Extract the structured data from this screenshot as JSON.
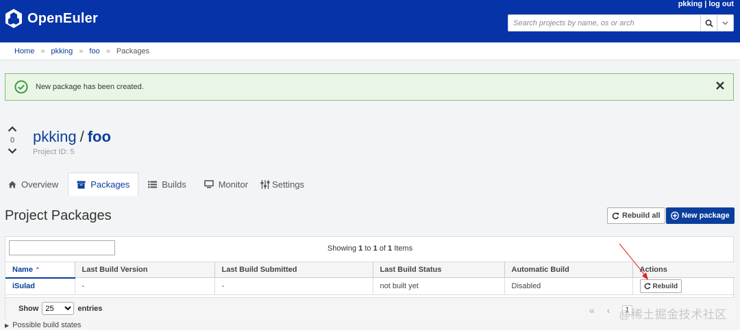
{
  "header": {
    "brand": "OpenEuler",
    "user": "pkking",
    "logout": "log out",
    "search_placeholder": "Search projects by name, os or arch"
  },
  "breadcrumb": {
    "items": [
      "Home",
      "pkking",
      "foo"
    ],
    "current": "Packages"
  },
  "alert": {
    "message": "New package has been created."
  },
  "project": {
    "owner": "pkking",
    "name": "foo",
    "id_label": "Project ID: 5",
    "votes": "0"
  },
  "tabs": [
    {
      "label": "Overview",
      "icon": "home-icon"
    },
    {
      "label": "Packages",
      "icon": "archive-icon",
      "active": true
    },
    {
      "label": "Builds",
      "icon": "list-icon"
    },
    {
      "label": "Monitor",
      "icon": "monitor-icon"
    },
    {
      "label": "Settings",
      "icon": "sliders-icon"
    }
  ],
  "packages_section": {
    "title": "Project Packages",
    "rebuild_all": "Rebuild all",
    "new_package": "New package"
  },
  "table": {
    "showing_prefix": "Showing ",
    "showing_from": "1",
    "showing_to_word": " to ",
    "showing_to": "1",
    "showing_of_word": " of ",
    "showing_total": "1",
    "showing_suffix": " Items",
    "columns": [
      "Name",
      "Last Build Version",
      "Last Build Submitted",
      "Last Build Status",
      "Automatic Build",
      "Actions"
    ],
    "rows": [
      {
        "name": "iSulad",
        "version": "-",
        "submitted": "-",
        "status": "not built yet",
        "auto": "Disabled",
        "action": "Rebuild"
      }
    ],
    "show_label": "Show",
    "entries_label": "entries",
    "page_size": "25",
    "page_number": "1"
  },
  "possible_states": "Possible build states",
  "watermark": "@稀土掘金技术社区",
  "colors": {
    "brand": "#0633a8",
    "link": "#0a3e9c",
    "success_bg": "#e9f6e6",
    "success_border": "#7dbf74"
  }
}
